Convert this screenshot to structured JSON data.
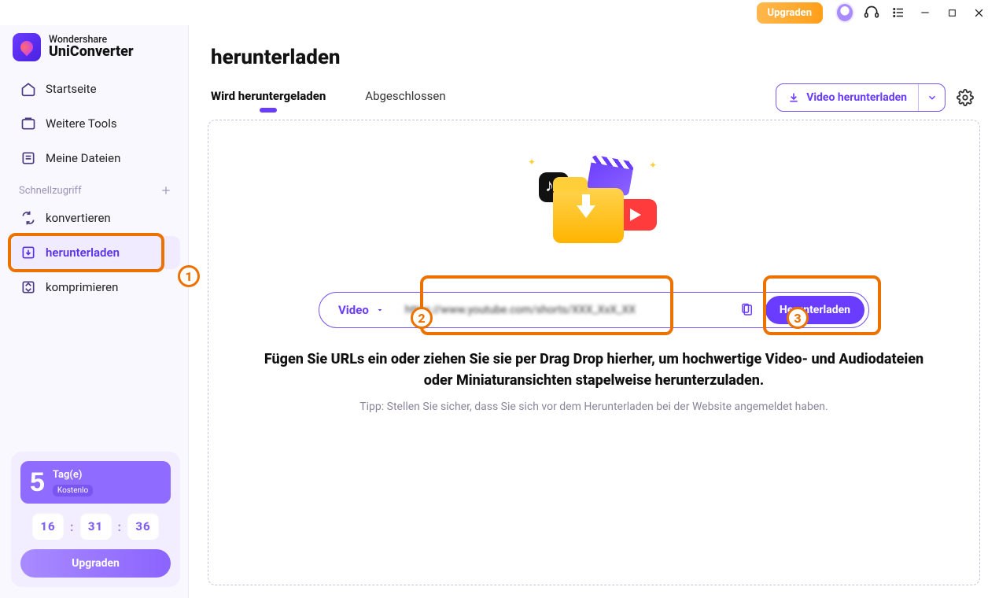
{
  "titlebar": {
    "upgrade_label": "Upgraden"
  },
  "brand": {
    "top": "Wondershare",
    "bottom": "UniConverter"
  },
  "nav": {
    "items": [
      {
        "label": "Startseite"
      },
      {
        "label": "Weitere Tools"
      },
      {
        "label": "Meine Dateien"
      }
    ]
  },
  "quick_access": {
    "label": "Schnellzugriff",
    "items": [
      {
        "label": "konvertieren"
      },
      {
        "label": "herunterladen"
      },
      {
        "label": "komprimieren"
      }
    ]
  },
  "promo": {
    "days_number": "5",
    "days_label": "Tag(e)",
    "badge": "Kostenlo",
    "timer": {
      "h": "16",
      "m": "31",
      "s": "36"
    },
    "button": "Upgraden"
  },
  "page": {
    "title": "herunterladen",
    "tabs": [
      {
        "label": "Wird heruntergeladen"
      },
      {
        "label": "Abgeschlossen"
      }
    ],
    "download_button": "Video herunterladen"
  },
  "url_bar": {
    "type_label": "Video",
    "input_value": "https://www.youtube.com/shorts/XXX_XxX_XX",
    "submit_label": "Herunterladen"
  },
  "instructions": {
    "main": "Fügen Sie URLs ein oder ziehen Sie sie per Drag  Drop hierher, um hochwertige Video- und Audiodateien oder Miniaturansichten stapelweise herunterzuladen.",
    "tip": "Tipp: Stellen Sie sicher, dass Sie sich vor dem Herunterladen bei der Website angemeldet haben."
  },
  "markers": {
    "one": "1",
    "two": "2",
    "three": "3"
  }
}
